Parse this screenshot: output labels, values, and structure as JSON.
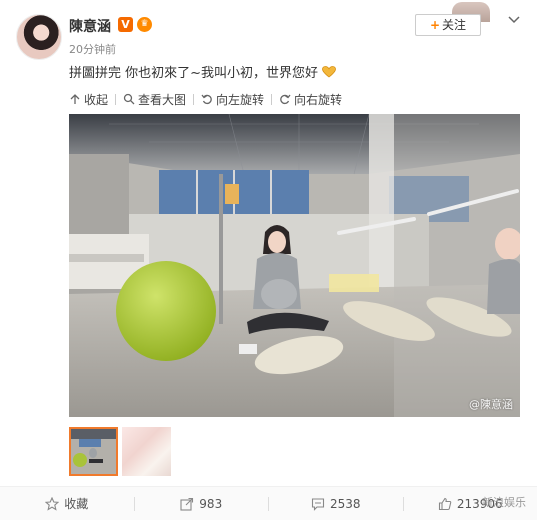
{
  "post": {
    "username": "陳意涵",
    "v_badge": "V",
    "time": "20分钟前",
    "text": "拼圖拼完 你也初來了~我叫小初，世界您好",
    "follow_label": "关注",
    "follow_plus": "+"
  },
  "toolbar": {
    "collapse": "收起",
    "view_large": "查看大图",
    "rotate_left": "向左旋转",
    "rotate_right": "向右旋转"
  },
  "photo": {
    "watermark": "@陳意涵"
  },
  "footer": {
    "favorite": "收藏",
    "reposts": "983",
    "comments": "2538",
    "likes": "213906",
    "watermark": "新浪娱乐"
  },
  "icons": [
    "more-chevron-icon",
    "collapse-icon",
    "search-icon",
    "rotate-left-icon",
    "rotate-right-icon",
    "heart-icon",
    "star-icon",
    "share-icon",
    "comment-icon",
    "like-icon"
  ],
  "colors": {
    "accent": "#ff8200",
    "thumb_border": "#f07a2c"
  }
}
